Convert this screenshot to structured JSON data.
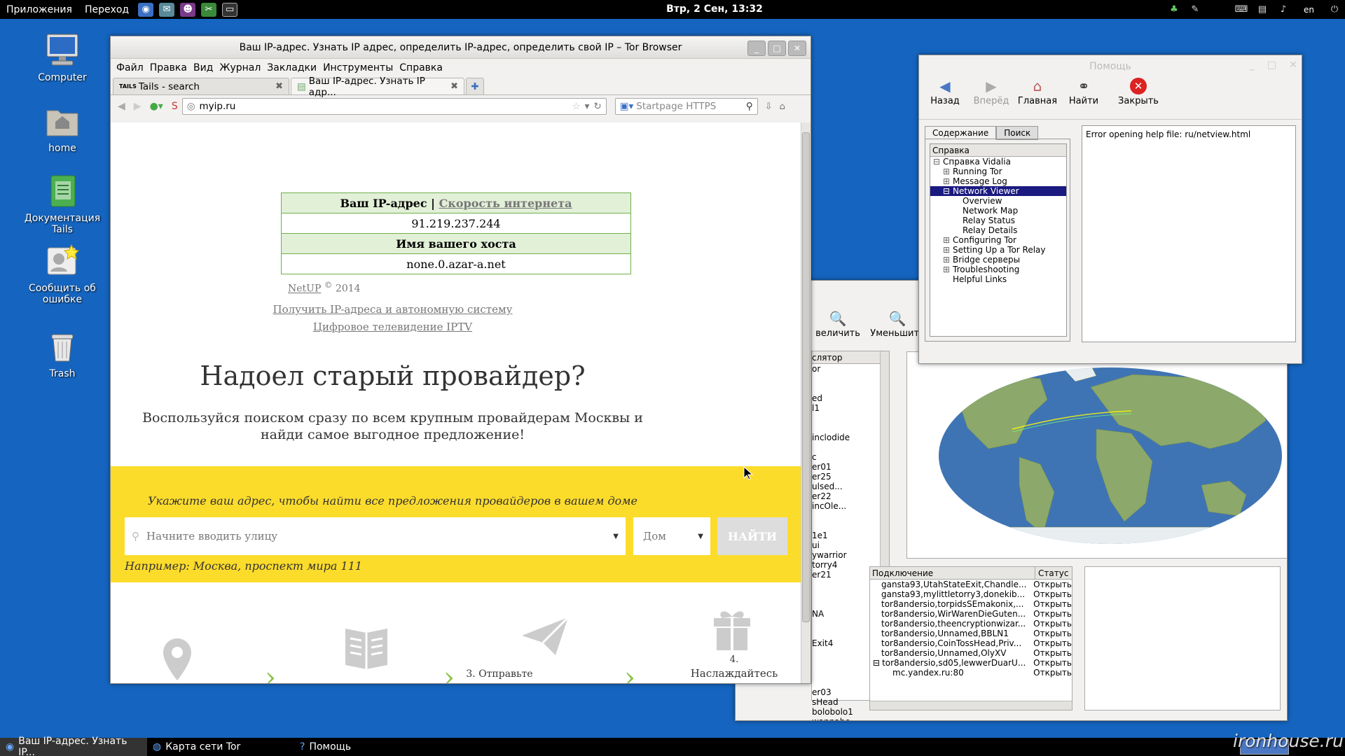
{
  "top_panel": {
    "menus": [
      "Приложения",
      "Переход"
    ],
    "clock": "Втр, 2 Сен, 13:32",
    "lang": "en"
  },
  "desktop": {
    "icons": [
      {
        "label": "Computer",
        "icon": "computer-icon"
      },
      {
        "label": "home",
        "icon": "folder-home-icon"
      },
      {
        "label": "Документация Tails",
        "icon": "documentation-icon"
      },
      {
        "label": "Сообщить об ошибке",
        "icon": "bug-report-icon"
      },
      {
        "label": "Trash",
        "icon": "trash-icon"
      }
    ]
  },
  "browser": {
    "title": "Ваш IP-адрес. Узнать IP адрес, определить IP-адрес, определить свой IP – Tor Browser",
    "menu": [
      "Файл",
      "Правка",
      "Вид",
      "Журнал",
      "Закладки",
      "Инструменты",
      "Справка"
    ],
    "tabs": [
      {
        "label": "Tails - search",
        "favicon": "TAILS"
      },
      {
        "label": "Ваш IP-адрес. Узнать IP адр..."
      }
    ],
    "url": "myip.ru",
    "search_placeholder": "Startpage HTTPS",
    "page": {
      "ip_header": "Ваш IP-адрес",
      "ip_header_sep": "|",
      "speed_link": "Скорость интернета",
      "ip_value": "91.219.237.244",
      "host_header": "Имя вашего хоста",
      "host_value": "none.0.azar-a.net",
      "copyright_link": "NetUP",
      "copyright_mark": "©",
      "copyright_year": "2014",
      "link1": "Получить IP-адреса и автономную систему",
      "link2": "Цифровое телевидение IPTV",
      "headline": "Надоел старый провайдер?",
      "subheadline": "Воспользуйся поиском сразу по всем крупным провайдерам Москвы и найди самое выгодное предложение!",
      "yellow_title": "Укажите ваш адрес, чтобы найти все предложения провайдеров в вашем доме",
      "street_placeholder": "Начните вводить улицу",
      "house_placeholder": "Дом",
      "find_button": "НАЙТИ",
      "example": "Например: Москва, проспект мира 111",
      "step3": "3. Отправьте",
      "step4_num": "4.",
      "step4": "Наслаждайтесь"
    }
  },
  "help": {
    "title": "Помощь",
    "toolbar": [
      {
        "label": "Назад",
        "icon": "back-arrow-icon"
      },
      {
        "label": "Вперёд",
        "icon": "forward-arrow-icon"
      },
      {
        "label": "Главная",
        "icon": "home-icon"
      },
      {
        "label": "Найти",
        "icon": "binoculars-icon"
      },
      {
        "label": "Закрыть",
        "icon": "close-red-icon"
      }
    ],
    "tab_contents": "Содержание",
    "tab_search": "Поиск",
    "tree_header": "Справка",
    "tree": [
      {
        "label": "Справка Vidalia",
        "indent": 0,
        "expander": "⊟"
      },
      {
        "label": "Running Tor",
        "indent": 1,
        "expander": "⊞"
      },
      {
        "label": "Message Log",
        "indent": 1,
        "expander": "⊞"
      },
      {
        "label": "Network Viewer",
        "indent": 1,
        "expander": "⊟",
        "selected": true
      },
      {
        "label": "Overview",
        "indent": 2,
        "expander": ""
      },
      {
        "label": "Network Map",
        "indent": 2,
        "expander": ""
      },
      {
        "label": "Relay Status",
        "indent": 2,
        "expander": ""
      },
      {
        "label": "Relay Details",
        "indent": 2,
        "expander": ""
      },
      {
        "label": "Configuring Tor",
        "indent": 1,
        "expander": "⊞"
      },
      {
        "label": "Setting Up a Tor Relay",
        "indent": 1,
        "expander": "⊞"
      },
      {
        "label": "Bridge серверы",
        "indent": 1,
        "expander": "⊞"
      },
      {
        "label": "Troubleshooting",
        "indent": 1,
        "expander": "⊞"
      },
      {
        "label": "Helpful Links",
        "indent": 1,
        "expander": ""
      }
    ],
    "error_text": "Error opening help file: ru/netview.html"
  },
  "netmap": {
    "zoom_in": "величить",
    "zoom_out": "Уменьшить",
    "relay_header": "слятор",
    "relays": [
      "or",
      "",
      "",
      "ed",
      "l1",
      "",
      "",
      "inclodide",
      "",
      "c",
      "er01",
      "er25",
      "ulsed...",
      "er22",
      "incOle...",
      "",
      "",
      "1e1",
      "ui",
      "ywarrior",
      "torry4",
      "er21",
      "",
      "",
      "",
      "NA",
      "",
      "",
      "Exit4",
      "",
      "",
      "",
      "",
      "er03",
      "sHead",
      "bolobolo1",
      "wannabe"
    ],
    "conn_header": "Подключение",
    "status_header": "Статус",
    "connections": [
      {
        "name": "gansta93,UtahStateExit,Chandle...",
        "status": "Открыть",
        "indent": 1
      },
      {
        "name": "gansta93,mylittletorry3,donekib...",
        "status": "Открыть",
        "indent": 1
      },
      {
        "name": "tor8andersio,torpidsSEmakonix,...",
        "status": "Открыть",
        "indent": 1
      },
      {
        "name": "tor8andersio,WirWarenDieGuten...",
        "status": "Открыть",
        "indent": 1
      },
      {
        "name": "tor8andersio,theencryptionwizar...",
        "status": "Открыть",
        "indent": 1
      },
      {
        "name": "tor8andersio,Unnamed,BBLN1",
        "status": "Открыть",
        "indent": 1
      },
      {
        "name": "tor8andersio,CoinTossHead,Priv...",
        "status": "Открыть",
        "indent": 1
      },
      {
        "name": "tor8andersio,Unnamed,OlyXV",
        "status": "Открыть",
        "indent": 1
      },
      {
        "name": "tor8andersio,sd05,lewwerDuarU...",
        "status": "Открыть",
        "indent": 1,
        "expander": "⊟"
      },
      {
        "name": "mc.yandex.ru:80",
        "status": "Открыть",
        "indent": 2
      }
    ]
  },
  "taskbar": {
    "tasks": [
      {
        "label": "Ваш IP-адрес. Узнать IP...",
        "active": true
      },
      {
        "label": "Карта сети Tor",
        "active": false
      },
      {
        "label": "Помощь",
        "active": false
      }
    ]
  },
  "watermark": "ironhouse.ru"
}
